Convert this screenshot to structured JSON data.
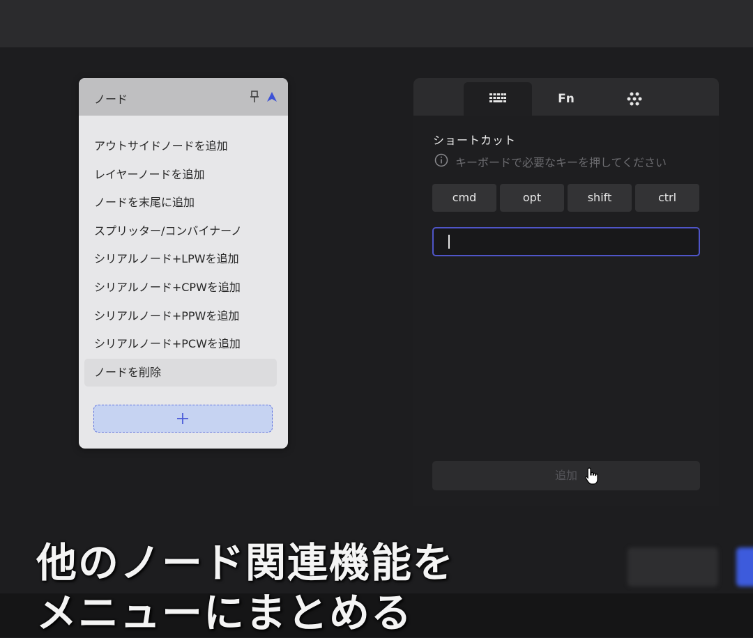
{
  "node_menu": {
    "title": "ノード",
    "items": [
      "アウトサイドノードを追加",
      "レイヤーノードを追加",
      "ノードを末尾に追加",
      "スプリッター/コンバイナーノ",
      "シリアルノード+LPWを追加",
      "シリアルノード+CPWを追加",
      "シリアルノード+PPWを追加",
      "シリアルノード+PCWを追加",
      "ノードを削除"
    ],
    "add_symbol": "+"
  },
  "tabs": {
    "keyboard_icon": "keyboard-icon",
    "fn_label": "Fn",
    "gesture_icon": "gesture-icon"
  },
  "shortcut": {
    "title": "ショートカット",
    "hint": "キーボードで必要なキーを押してください",
    "modifiers": [
      "cmd",
      "opt",
      "shift",
      "ctrl"
    ],
    "input_value": "",
    "add_label": "追加"
  },
  "caption": {
    "line1": "他のノード関連機能を",
    "line2": "メニューにまとめる"
  },
  "colors": {
    "accent": "#4f55c8",
    "add_node_bg": "#c6d3f2"
  }
}
